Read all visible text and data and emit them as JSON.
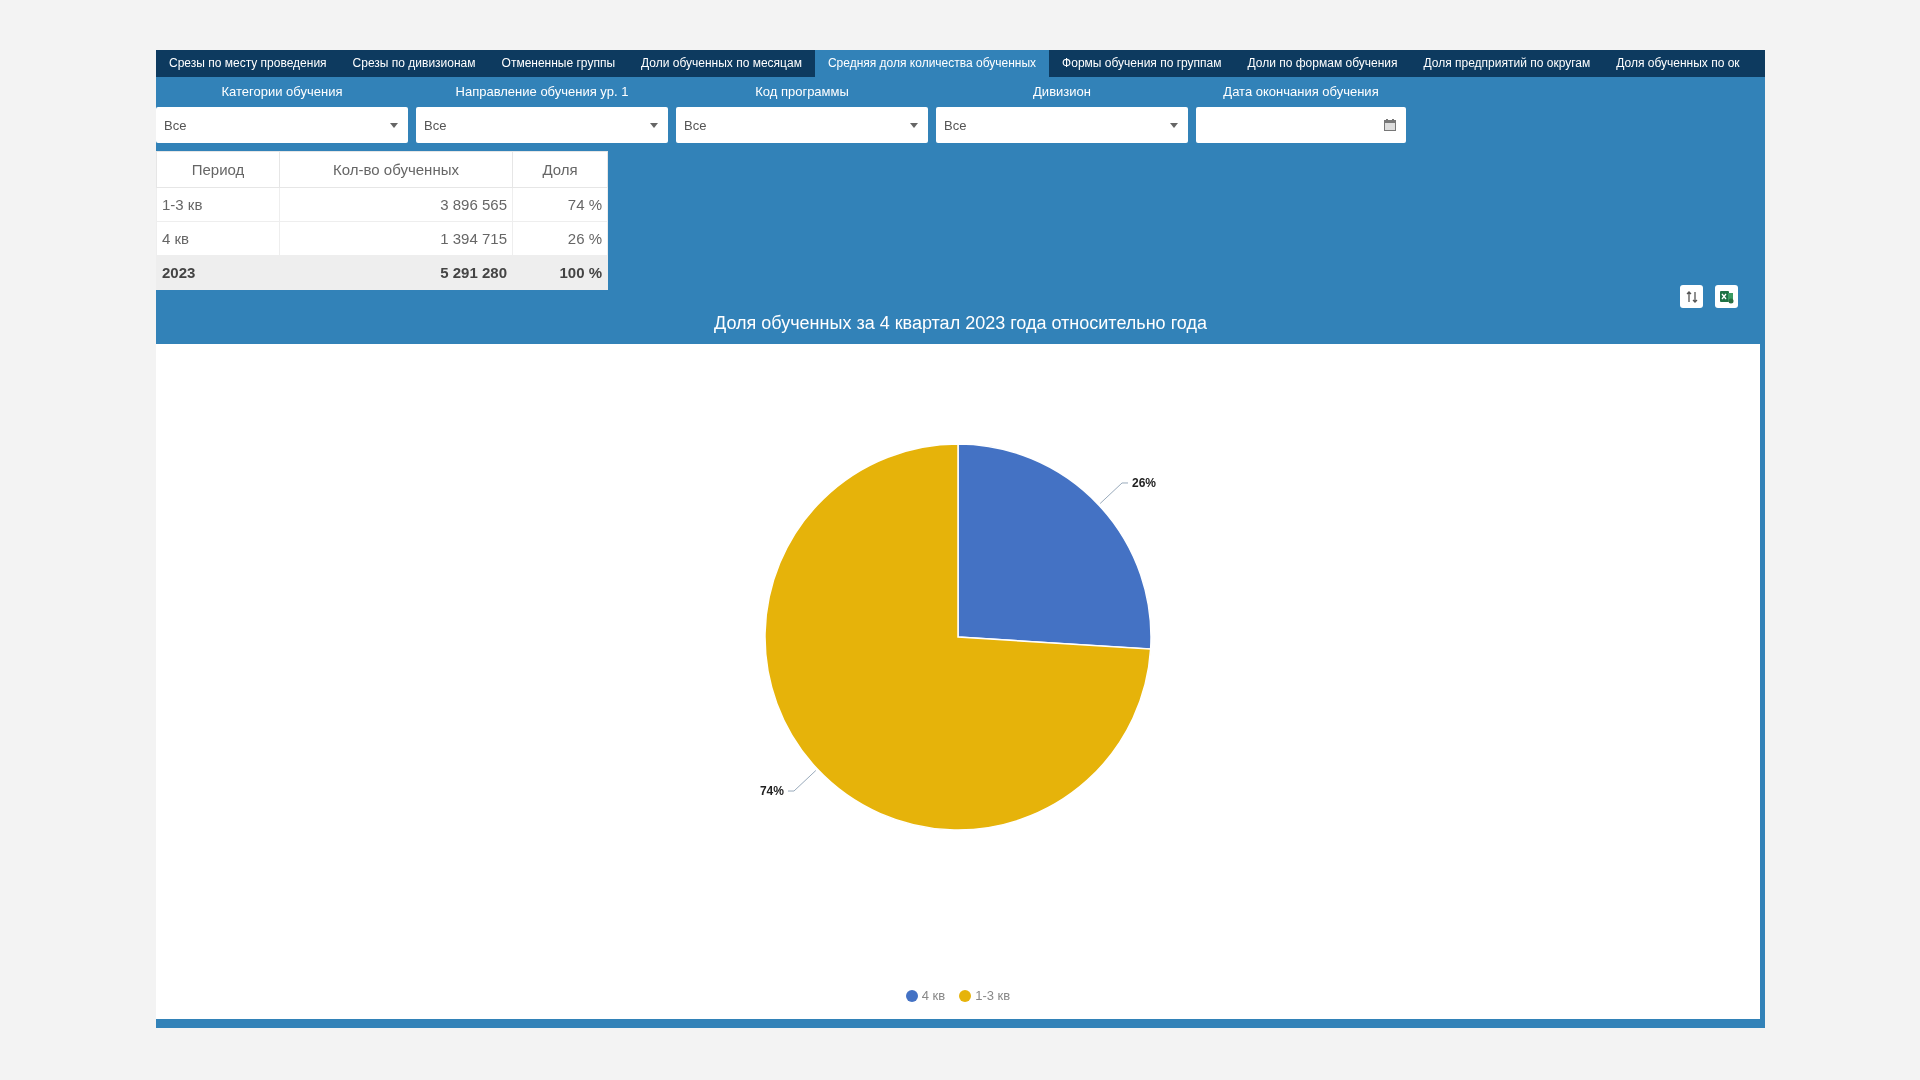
{
  "tabs": [
    {
      "label": "Срезы по месту проведения",
      "selected": false
    },
    {
      "label": "Срезы по дивизионам",
      "selected": false
    },
    {
      "label": "Отмененные группы",
      "selected": false
    },
    {
      "label": "Доли обученных по месяцам",
      "selected": false
    },
    {
      "label": "Средняя доля количества обученных",
      "selected": true
    },
    {
      "label": "Формы обучения по группам",
      "selected": false
    },
    {
      "label": "Доли по формам обучения",
      "selected": false
    },
    {
      "label": "Доля предприятий по округам",
      "selected": false
    },
    {
      "label": "Доля обученных по ок",
      "selected": false
    }
  ],
  "filters": [
    {
      "label": "Категории обучения",
      "kind": "select",
      "value": "Все"
    },
    {
      "label": "Направление обучения ур. 1",
      "kind": "select",
      "value": "Все"
    },
    {
      "label": "Код программы",
      "kind": "select",
      "value": "Все"
    },
    {
      "label": "Дивизион",
      "kind": "select",
      "value": "Все"
    },
    {
      "label": "Дата окончания обучения",
      "kind": "date"
    }
  ],
  "table": {
    "columns": [
      "Период",
      "Кол-во обученных",
      "Доля"
    ],
    "rows": [
      {
        "cells": [
          "1-3 кв",
          "3 896 565",
          "74 %"
        ],
        "total": false
      },
      {
        "cells": [
          "4 кв",
          "1 394 715",
          "26 %"
        ],
        "total": false
      },
      {
        "cells": [
          "2023",
          "5 291 280",
          "100 %"
        ],
        "total": true
      }
    ]
  },
  "chart": {
    "title": "Доля обученных за 4 квартал 2023 года относительно года",
    "chart_data": {
      "type": "pie",
      "categories": [
        "4 кв",
        "1-3 кв"
      ],
      "values": [
        26,
        74
      ],
      "legend": true,
      "colors": [
        "#4472c4",
        "#e6b30a"
      ],
      "data_labels": true,
      "value_labels": [
        "26%",
        "74%"
      ]
    }
  }
}
